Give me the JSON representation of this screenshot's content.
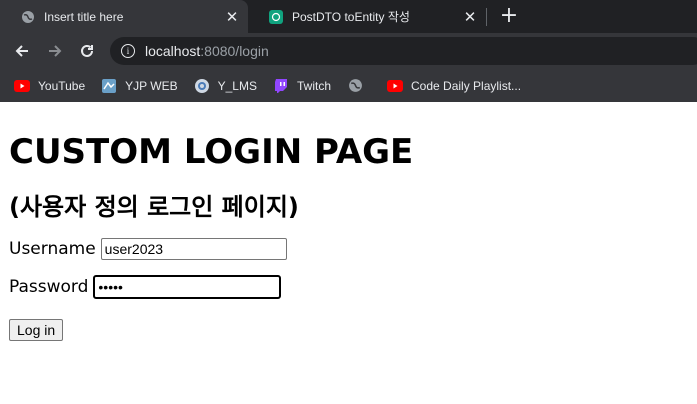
{
  "browser": {
    "tabs": [
      {
        "title": "Insert title here",
        "icon": "globe-icon",
        "active": true
      },
      {
        "title": "PostDTO toEntity 작성",
        "icon": "chatgpt-icon",
        "active": false
      }
    ],
    "address": {
      "host": "localhost",
      "rest": ":8080/login"
    },
    "bookmarks": [
      {
        "label": "YouTube",
        "icon": "youtube-icon"
      },
      {
        "label": "YJP WEB",
        "icon": "yjp-icon"
      },
      {
        "label": "Y_LMS",
        "icon": "lms-icon"
      },
      {
        "label": "Twitch",
        "icon": "twitch-icon"
      },
      {
        "label": "",
        "icon": "globe-icon"
      },
      {
        "label": "Code Daily Playlist...",
        "icon": "youtube-icon"
      }
    ]
  },
  "page": {
    "heading": "CUSTOM LOGIN PAGE",
    "subheading": "(사용자 정의 로그인 페이지)",
    "form": {
      "username_label": "Username",
      "username_value": "user2023",
      "password_label": "Password",
      "password_value": "•••••",
      "submit_label": "Log in"
    }
  },
  "colors": {
    "chrome_dark": "#202124",
    "chrome_toolbar": "#35363a",
    "text_light": "#e8eaed"
  }
}
